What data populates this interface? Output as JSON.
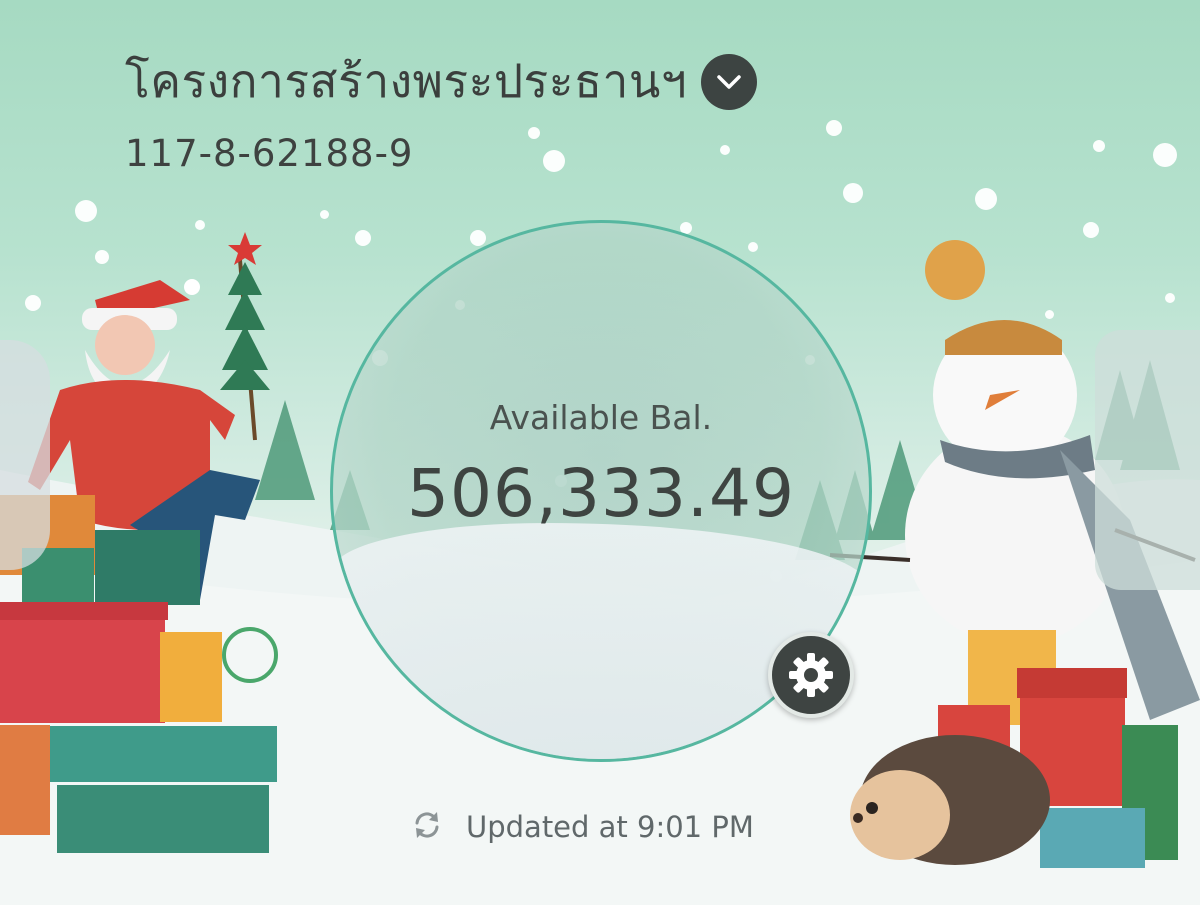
{
  "account": {
    "name": "โครงการสร้างพระประธานฯ",
    "number": "117-8-62188-9"
  },
  "balance": {
    "label": "Available Bal.",
    "value": "506,333.49"
  },
  "status": {
    "updated_text": "Updated at 9:01 PM"
  },
  "icons": {
    "dropdown": "chevron-down-icon",
    "settings": "gear-icon",
    "refresh": "refresh-icon"
  },
  "colors": {
    "accent_ring": "#56b7a0",
    "dark_button": "#3d4442",
    "background_top": "#a6dac2"
  }
}
